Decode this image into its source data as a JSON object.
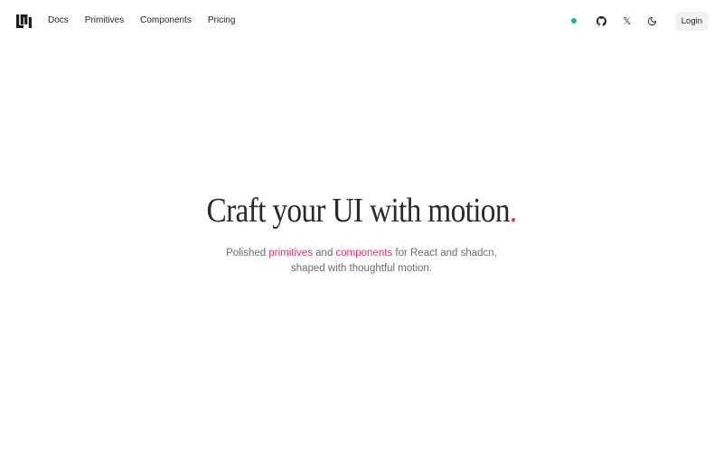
{
  "header": {
    "nav": [
      {
        "label": "Docs"
      },
      {
        "label": "Primitives"
      },
      {
        "label": "Components"
      },
      {
        "label": "Pricing"
      }
    ],
    "status_color": "#10c07a",
    "icons": [
      "github-icon",
      "x-icon",
      "moon-icon"
    ],
    "x_glyph": "𝕏",
    "login_label": "Login"
  },
  "hero": {
    "title": "Craft your UI with motion",
    "title_dot": ".",
    "accent_color": "#e5306b",
    "sub": {
      "part1": "Polished ",
      "link1": "primitives",
      "part2": " and ",
      "link2": "components",
      "part3": " for React and shadcn,",
      "line2": "shaped with thoughtful motion."
    }
  }
}
